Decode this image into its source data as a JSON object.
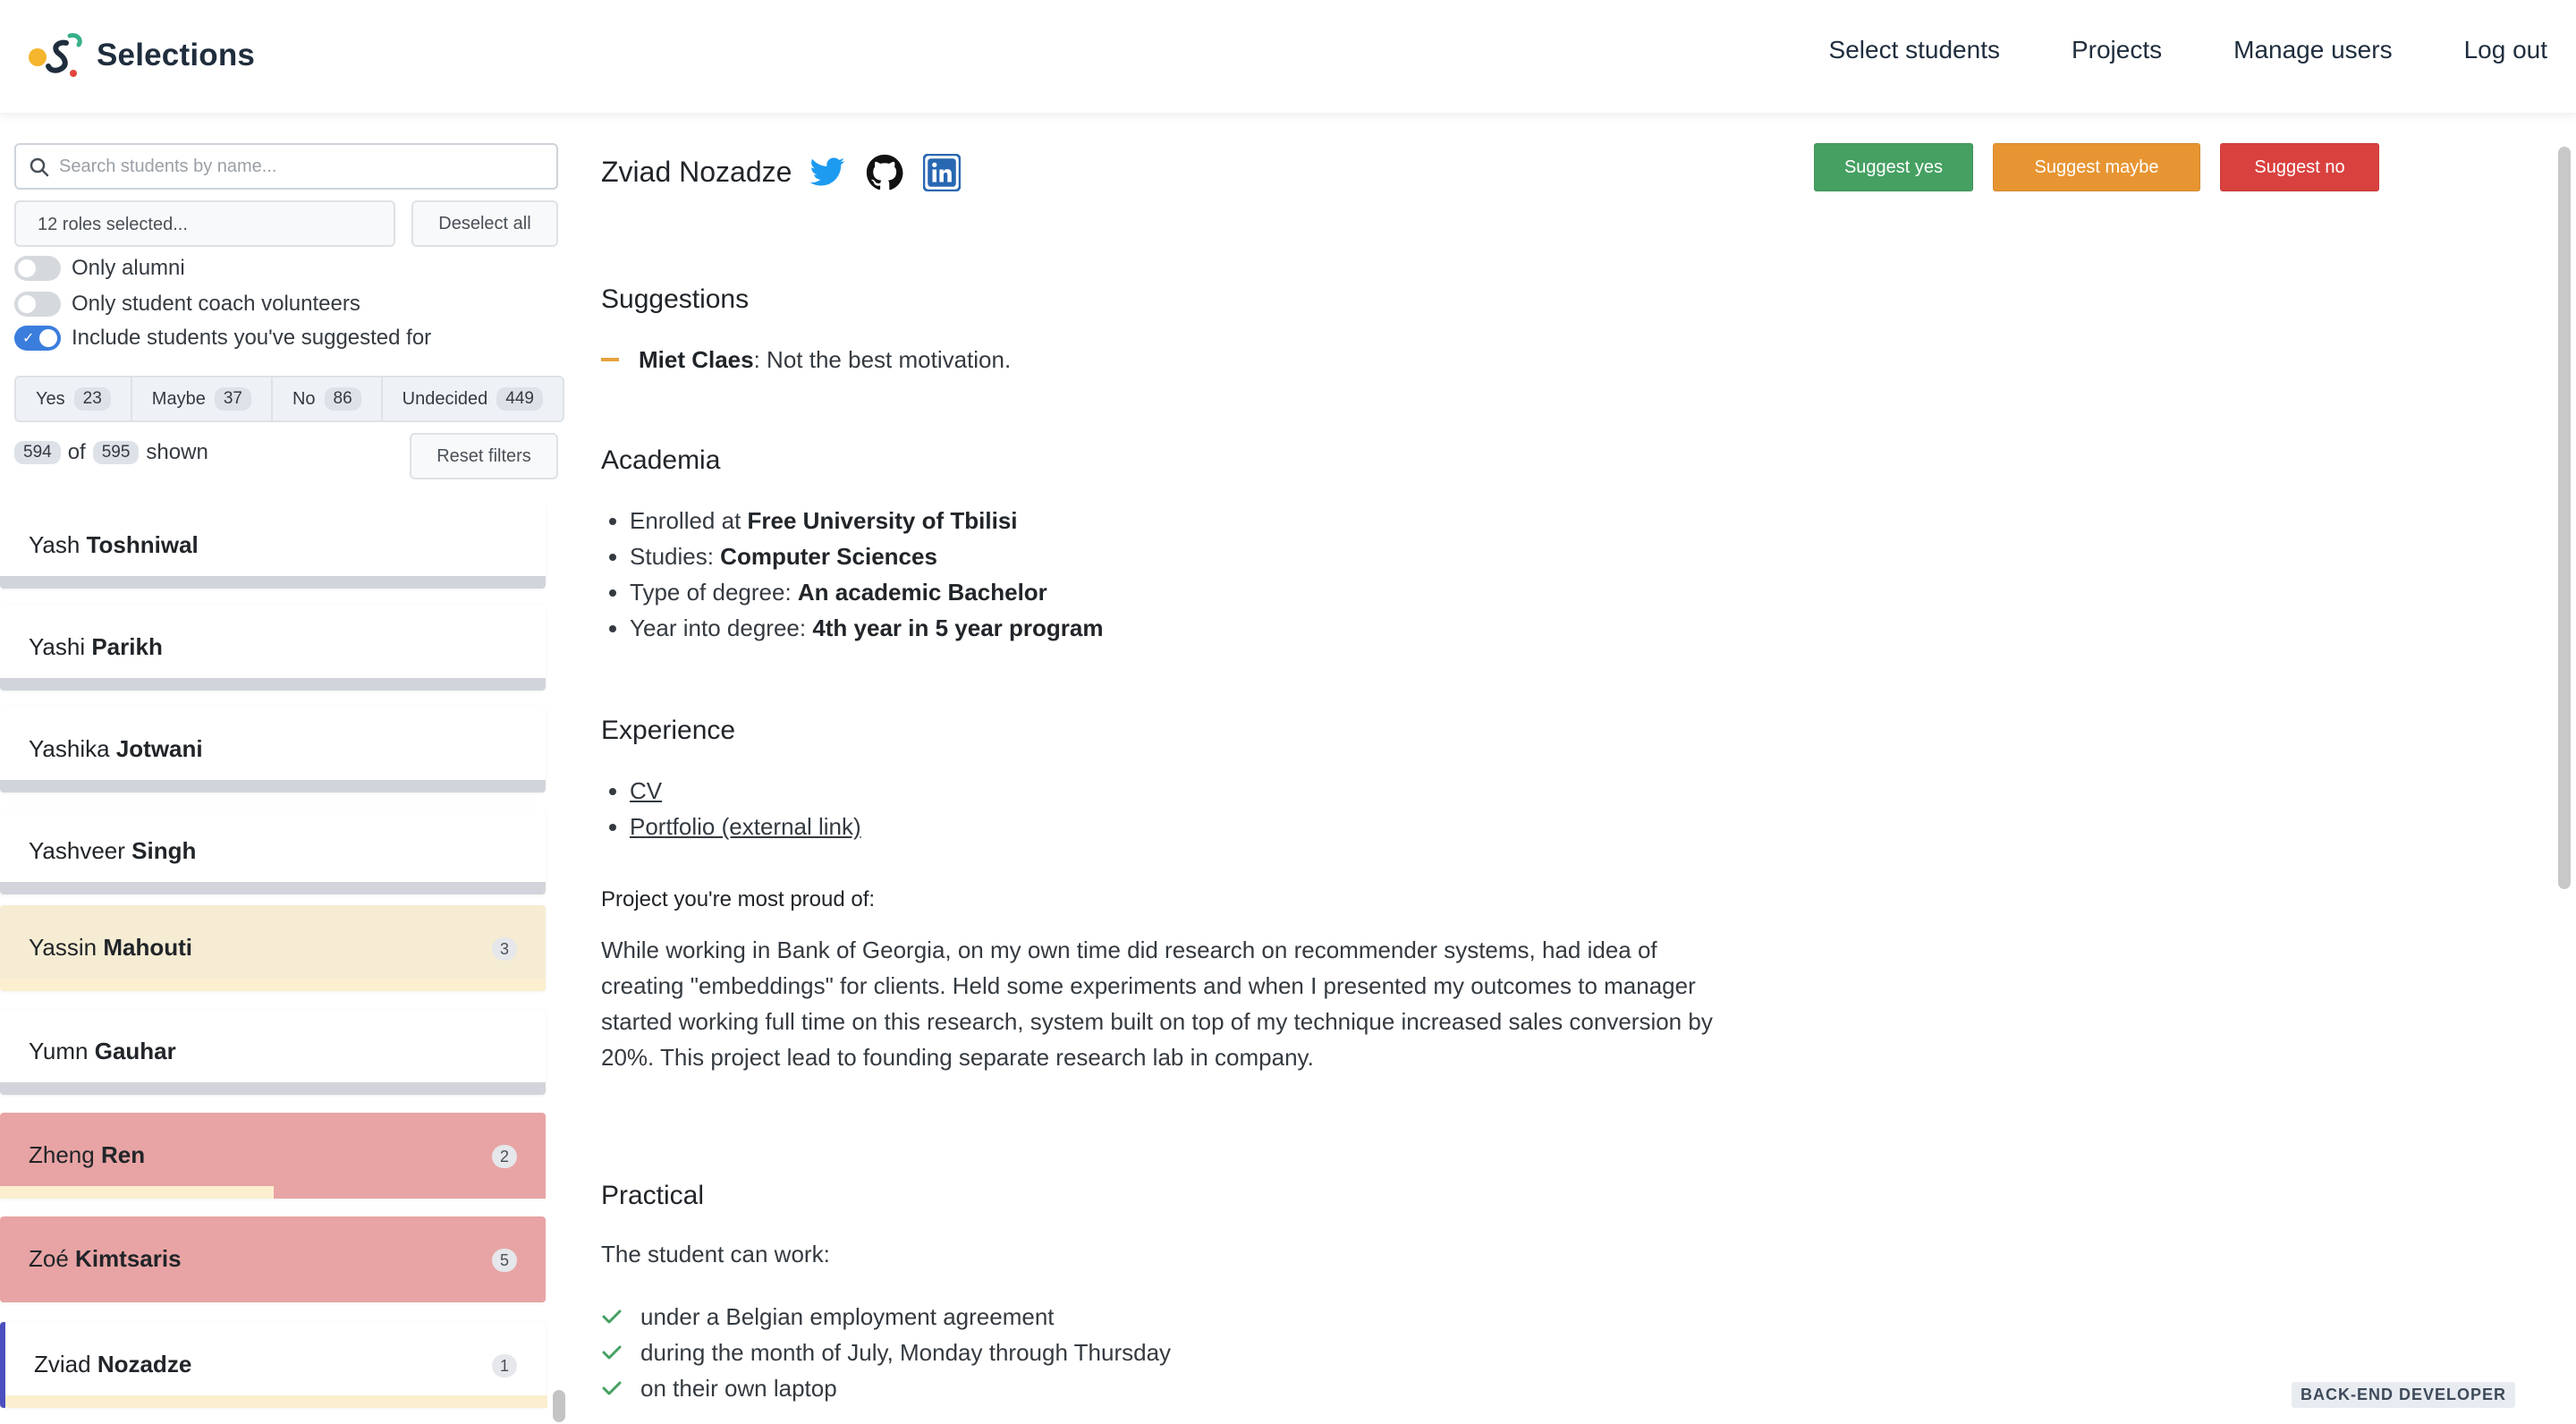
{
  "navbar": {
    "brand": "Selections",
    "links": [
      "Select students",
      "Projects",
      "Manage users",
      "Log out"
    ]
  },
  "filters": {
    "search_placeholder": "Search students by name...",
    "roles_label": "12 roles selected...",
    "deselect_label": "Deselect all",
    "toggles": [
      {
        "label": "Only alumni",
        "on": false
      },
      {
        "label": "Only student coach volunteers",
        "on": false
      },
      {
        "label": "Include students you've suggested for",
        "on": true
      }
    ],
    "segments": [
      {
        "label": "Yes",
        "count": "23"
      },
      {
        "label": "Maybe",
        "count": "37"
      },
      {
        "label": "No",
        "count": "86"
      },
      {
        "label": "Undecided",
        "count": "449"
      }
    ],
    "shown_count": "594",
    "shown_of": "of",
    "total_count": "595",
    "shown_label": "shown",
    "reset_label": "Reset filters"
  },
  "students": [
    {
      "first": "Yash",
      "last": "Toshniwal",
      "status": "undecided",
      "badge": ""
    },
    {
      "first": "Yashi",
      "last": "Parikh",
      "status": "undecided",
      "badge": ""
    },
    {
      "first": "Yashika",
      "last": "Jotwani",
      "status": "undecided",
      "badge": ""
    },
    {
      "first": "Yashveer",
      "last": "Singh",
      "status": "undecided",
      "badge": ""
    },
    {
      "first": "Yassin",
      "last": "Mahouti",
      "status": "maybe",
      "badge": "3"
    },
    {
      "first": "Yumn",
      "last": "Gauhar",
      "status": "undecided",
      "badge": ""
    },
    {
      "first": "Zheng",
      "last": "Ren",
      "status": "no",
      "badge": "2"
    },
    {
      "first": "Zoé",
      "last": "Kimtsaris",
      "status": "no",
      "badge": "5"
    },
    {
      "first": "Zviad",
      "last": "Nozadze",
      "status": "active",
      "badge": "1"
    }
  ],
  "detail": {
    "name": "Zviad Nozadze",
    "social_icons": [
      "twitter-icon",
      "github-icon",
      "linkedin-icon"
    ],
    "actions": {
      "yes": "Suggest yes",
      "maybe": "Suggest maybe",
      "no": "Suggest no"
    },
    "suggestions_title": "Suggestions",
    "suggestion": {
      "author": "Miet Claes",
      "text": ": Not the best motivation."
    },
    "academia_title": "Academia",
    "academia": [
      {
        "label": "Enrolled at ",
        "value": "Free University of Tbilisi"
      },
      {
        "label": "Studies: ",
        "value": "Computer Sciences"
      },
      {
        "label": "Type of degree: ",
        "value": "An academic Bachelor"
      },
      {
        "label": "Year into degree: ",
        "value": "4th year in 5 year program"
      }
    ],
    "experience_title": "Experience",
    "experience_links": [
      "CV",
      "Portfolio (external link)"
    ],
    "proud_label": "Project you're most proud of:",
    "proud_text": "While working in Bank of Georgia, on my own time did research on recommender systems, had idea of creating \"embeddings\" for clients. Held some experiments and when I presented my outcomes to manager started working full time on this research, system built on top of my technique increased sales conversion by 20%. This project lead to founding separate research lab in company.",
    "practical_title": "Practical",
    "can_work_label": "The student can work:",
    "work_conditions": [
      "under a Belgian employment agreement",
      "during the month of July, Monday through Thursday",
      "on their own laptop"
    ],
    "role_tag": "BACK-END DEVELOPER"
  },
  "colors": {
    "yes": "#45a062",
    "maybe": "#e79532",
    "no": "#d9413f",
    "maybe_card": "#f5ecd3",
    "no_card": "#e8a4a4",
    "accent": "#3b7ddd"
  }
}
